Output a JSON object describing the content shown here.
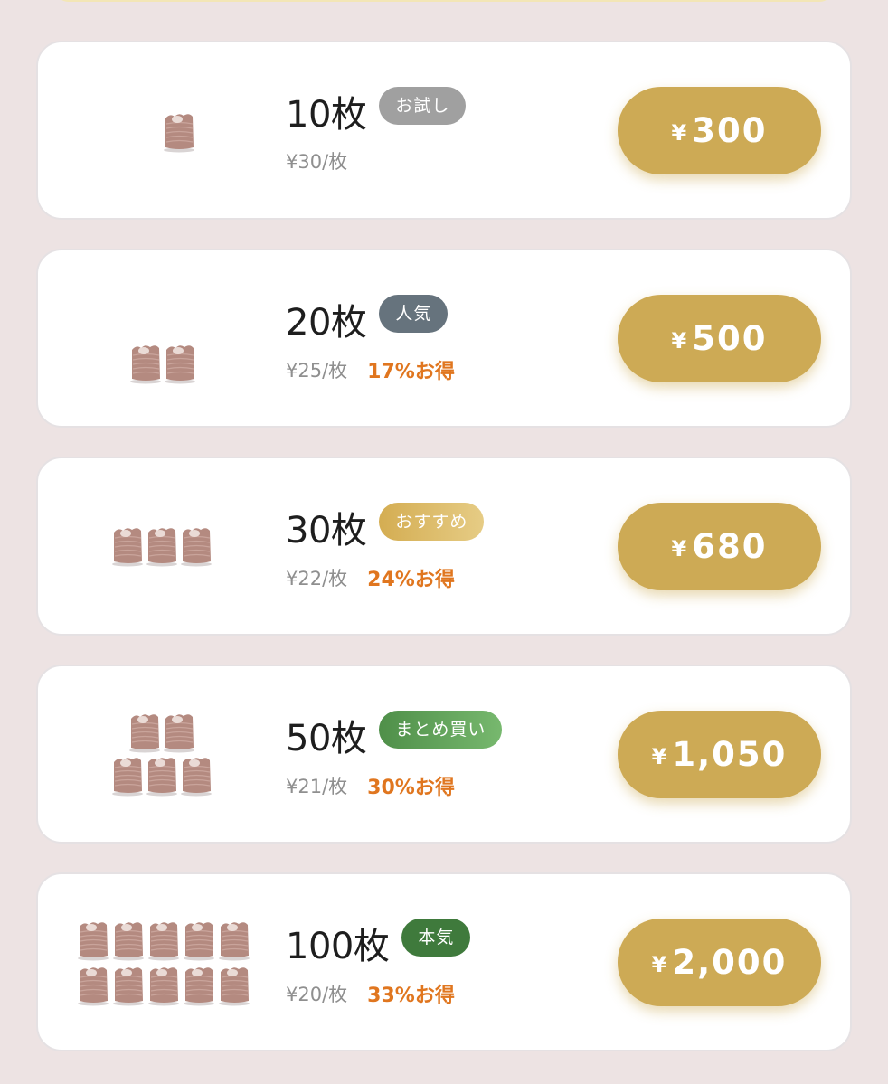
{
  "plans": [
    {
      "quantity": "10枚",
      "badge": "お試し",
      "badge_color": "#a0a0a0",
      "unit_price": "¥30/枚",
      "discount": "",
      "currency": "¥",
      "price": "300",
      "stack_count": 1
    },
    {
      "quantity": "20枚",
      "badge": "人気",
      "badge_color": "#66737d",
      "unit_price": "¥25/枚",
      "discount": "17%お得",
      "currency": "¥",
      "price": "500",
      "stack_count": 2
    },
    {
      "quantity": "30枚",
      "badge": "おすすめ",
      "badge_color": "#d9b864",
      "unit_price": "¥22/枚",
      "discount": "24%お得",
      "currency": "¥",
      "price": "680",
      "stack_count": 3
    },
    {
      "quantity": "50枚",
      "badge": "まとめ買い",
      "badge_color": "#5f9f5a",
      "unit_price": "¥21/枚",
      "discount": "30%お得",
      "currency": "¥",
      "price": "1,050",
      "stack_count": 5
    },
    {
      "quantity": "100枚",
      "badge": "本気",
      "badge_color": "#3f7a3c",
      "unit_price": "¥20/枚",
      "discount": "33%お得",
      "currency": "¥",
      "price": "2,000",
      "stack_count": 10
    }
  ],
  "colors": {
    "background": "#ede3e3",
    "price_button": "#cdaa55",
    "discount_text": "#e0761f"
  },
  "icons": {
    "product": "paper-stack-icon"
  }
}
